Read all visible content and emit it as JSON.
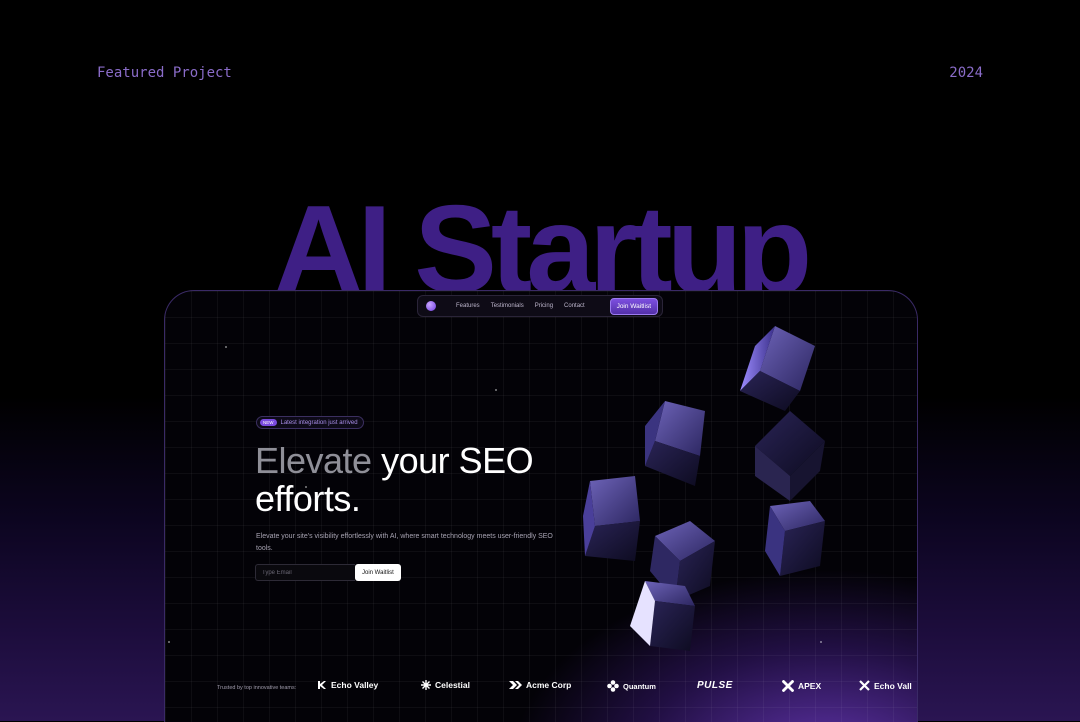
{
  "header": {
    "featured_label": "Featured Project",
    "year": "2024"
  },
  "hero_title": "AI Startup",
  "site": {
    "nav": {
      "links": [
        "Features",
        "Testimonials",
        "Pricing",
        "Contact"
      ],
      "cta": "Join Waitlist"
    },
    "badge": {
      "tag": "NEW",
      "text": "Latest integration just arrived"
    },
    "headline": {
      "part1": "Elevate",
      "part2": " your SEO",
      "part3": "efforts."
    },
    "subtext": "Elevate your site's visibility effortlessly with AI, where smart technology meets user-friendly SEO tools.",
    "form": {
      "placeholder": "Type Email",
      "button": "Join Waitlist"
    },
    "trusted_label": "Trusted by top innovative teams:",
    "logos": [
      {
        "name": "Echo Valley",
        "icon": "echo-valley-icon"
      },
      {
        "name": "Celestial",
        "icon": "celestial-icon"
      },
      {
        "name": "Acme Corp",
        "icon": "acme-corp-icon"
      },
      {
        "name": "Quantum",
        "icon": "quantum-icon"
      },
      {
        "name": "PULSE",
        "icon": ""
      },
      {
        "name": "APEX",
        "icon": "apex-icon"
      },
      {
        "name": "Echo Vall",
        "icon": "echo-valley-icon"
      }
    ],
    "colors": {
      "accent": "#7a4ae0",
      "title": "#3e1f85",
      "label": "#8a6cc9"
    }
  }
}
